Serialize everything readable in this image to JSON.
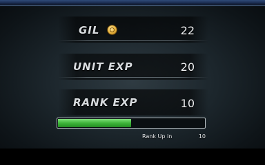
{
  "rewards": {
    "gil_label": "GIL",
    "gil_value": "22",
    "coin_icon": "gil-coin-icon",
    "unit_exp_label": "UNIT EXP",
    "unit_exp_value": "20",
    "rank_exp_label": "RANK EXP",
    "rank_exp_value": "10"
  },
  "rank_progress": {
    "label": "Rank Up in",
    "value": "10",
    "fill_fraction": 0.5,
    "fill_color": "#3fb43a"
  }
}
